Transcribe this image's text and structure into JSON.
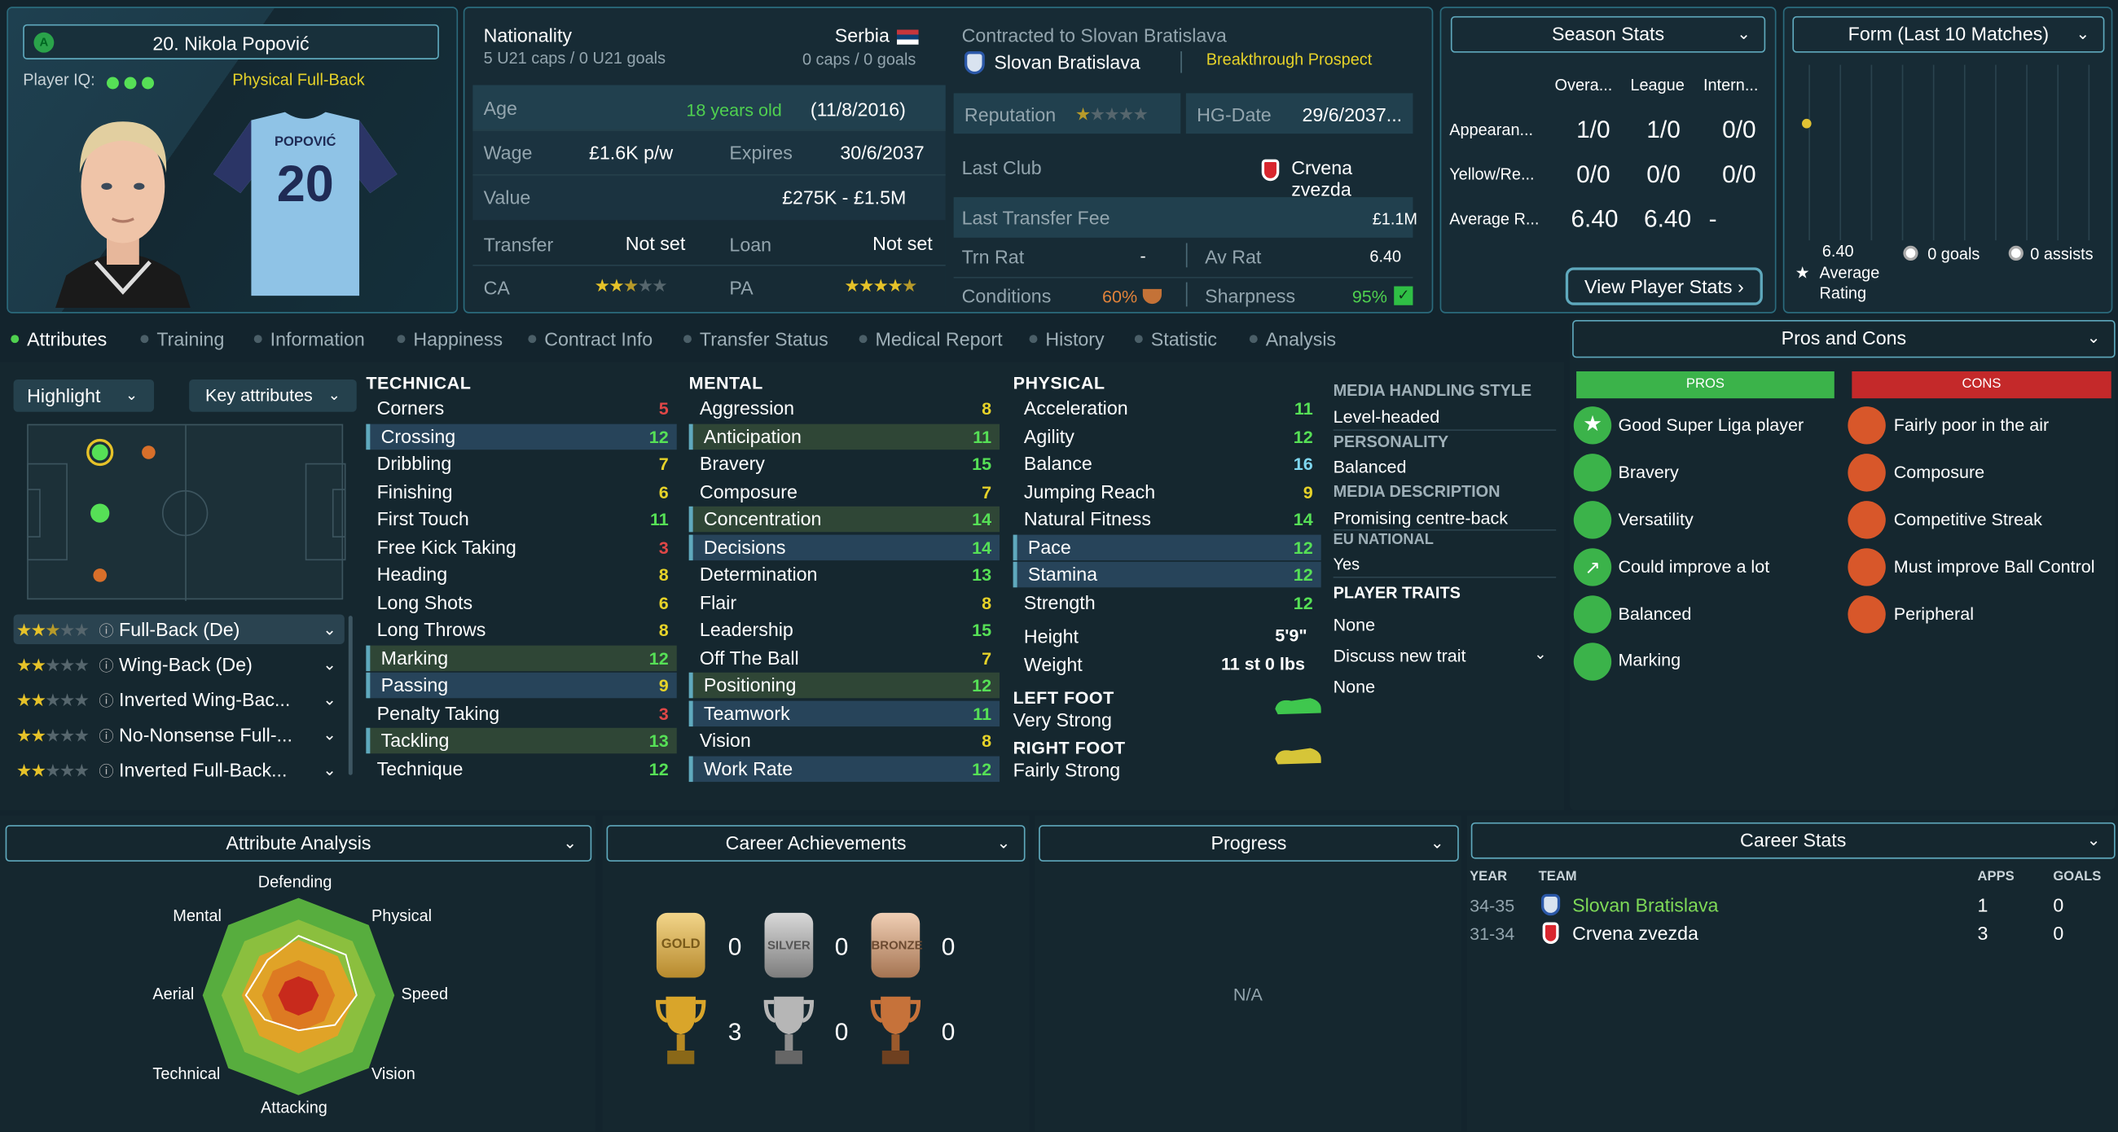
{
  "player": {
    "name": "20. Nikola Popović",
    "iq_label": "Player IQ:",
    "role_label": "Physical Full-Back",
    "shirt_name": "POPOVIĆ",
    "shirt_number": "20"
  },
  "nationality": {
    "label": "Nationality",
    "country": "Serbia",
    "u21": "5 U21 caps / 0 U21 goals",
    "caps": "0 caps / 0 goals"
  },
  "details": {
    "age_label": "Age",
    "age": "18 years old",
    "dob": "(11/8/2016)",
    "wage_label": "Wage",
    "wage": "£1.6K p/w",
    "expires_label": "Expires",
    "expires": "30/6/2037",
    "value_label": "Value",
    "value": "£275K - £1.5M",
    "transfer_label": "Transfer",
    "transfer": "Not set",
    "loan_label": "Loan",
    "loan": "Not set",
    "ca_label": "CA",
    "pa_label": "PA"
  },
  "contract": {
    "label": "Contracted to Slovan Bratislava",
    "club": "Slovan Bratislava",
    "prospect": "Breakthrough Prospect",
    "rep_label": "Reputation",
    "hg_label": "HG-Date",
    "hg": "29/6/2037...",
    "last_club_label": "Last Club",
    "last_club": "Crvena zvezda",
    "fee_label": "Last Transfer Fee",
    "fee": "£1.1M",
    "trn_label": "Trn Rat",
    "trn": "-",
    "av_label": "Av Rat",
    "av": "6.40",
    "cond_label": "Conditions",
    "cond": "60%",
    "sharp_label": "Sharpness",
    "sharp": "95%"
  },
  "season": {
    "title": "Season Stats",
    "cols": [
      "Overa...",
      "League",
      "Intern..."
    ],
    "rows": [
      {
        "label": "Appearan...",
        "v": [
          "1/0",
          "1/0",
          "0/0"
        ]
      },
      {
        "label": "Yellow/Re...",
        "v": [
          "0/0",
          "0/0",
          "0/0"
        ]
      },
      {
        "label": "Average R...",
        "v": [
          "6.40",
          "6.40",
          "-"
        ]
      }
    ],
    "button": "View Player Stats"
  },
  "form": {
    "title": "Form (Last 10 Matches)",
    "rating": "6.40",
    "rating_label": "Average Rating",
    "goals": "0 goals",
    "assists": "0 assists"
  },
  "tabs": [
    "Attributes",
    "Training",
    "Information",
    "Happiness",
    "Contract Info",
    "Transfer Status",
    "Medical Report",
    "History",
    "Statistic",
    "Analysis"
  ],
  "controls": {
    "highlight": "Highlight",
    "key": "Key attributes"
  },
  "technical": {
    "title": "TECHNICAL",
    "items": [
      [
        "Corners",
        "5"
      ],
      [
        "Crossing",
        "12"
      ],
      [
        "Dribbling",
        "7"
      ],
      [
        "Finishing",
        "6"
      ],
      [
        "First Touch",
        "11"
      ],
      [
        "Free Kick Taking",
        "3"
      ],
      [
        "Heading",
        "8"
      ],
      [
        "Long Shots",
        "6"
      ],
      [
        "Long Throws",
        "8"
      ],
      [
        "Marking",
        "12"
      ],
      [
        "Passing",
        "9"
      ],
      [
        "Penalty Taking",
        "3"
      ],
      [
        "Tackling",
        "13"
      ],
      [
        "Technique",
        "12"
      ]
    ]
  },
  "mental": {
    "title": "MENTAL",
    "items": [
      [
        "Aggression",
        "8"
      ],
      [
        "Anticipation",
        "11"
      ],
      [
        "Bravery",
        "15"
      ],
      [
        "Composure",
        "7"
      ],
      [
        "Concentration",
        "14"
      ],
      [
        "Decisions",
        "14"
      ],
      [
        "Determination",
        "13"
      ],
      [
        "Flair",
        "8"
      ],
      [
        "Leadership",
        "15"
      ],
      [
        "Off The Ball",
        "7"
      ],
      [
        "Positioning",
        "12"
      ],
      [
        "Teamwork",
        "11"
      ],
      [
        "Vision",
        "8"
      ],
      [
        "Work Rate",
        "12"
      ]
    ]
  },
  "physical": {
    "title": "PHYSICAL",
    "items": [
      [
        "Acceleration",
        "11"
      ],
      [
        "Agility",
        "12"
      ],
      [
        "Balance",
        "16"
      ],
      [
        "Jumping Reach",
        "9"
      ],
      [
        "Natural Fitness",
        "14"
      ],
      [
        "Pace",
        "12"
      ],
      [
        "Stamina",
        "12"
      ],
      [
        "Strength",
        "12"
      ]
    ],
    "height_label": "Height",
    "height": "5'9\"",
    "weight_label": "Weight",
    "weight": "11 st 0 lbs",
    "left_label": "LEFT FOOT",
    "left": "Very Strong",
    "right_label": "RIGHT FOOT",
    "right": "Fairly Strong"
  },
  "media": {
    "mh_label": "MEDIA HANDLING STYLE",
    "mh": "Level-headed",
    "pers_label": "PERSONALITY",
    "pers": "Balanced",
    "md_label": "MEDIA DESCRIPTION",
    "md": "Promising centre-back",
    "eu_label": "EU NATIONAL",
    "eu": "Yes",
    "traits_label": "PLAYER TRAITS",
    "traits": "None",
    "discuss": "Discuss new trait",
    "discuss_val": "None"
  },
  "roles": [
    "Full-Back (De)",
    "Wing-Back (De)",
    "Inverted Wing-Bac...",
    "No-Nonsense Full-...",
    "Inverted Full-Back..."
  ],
  "pros_cons": {
    "title": "Pros and Cons",
    "pros_label": "PROS",
    "cons_label": "CONS",
    "pros": [
      "Good Super Liga player",
      "Bravery",
      "Versatility",
      "Could improve a lot",
      "Balanced",
      "Marking"
    ],
    "cons": [
      "Fairly poor in the air",
      "Composure",
      "Competitive Streak",
      "Must improve Ball Control",
      "Peripheral"
    ]
  },
  "analysis": {
    "title": "Attribute Analysis",
    "labels": [
      "Defending",
      "Physical",
      "Speed",
      "Vision",
      "Attacking",
      "Technical",
      "Aerial",
      "Mental"
    ]
  },
  "achievements": {
    "title": "Career Achievements",
    "gold": "0",
    "silver": "0",
    "bronze": "0",
    "cup_gold": "3",
    "cup_silver": "0",
    "cup_bronze": "0",
    "medal_gold": "GOLD",
    "medal_silver": "SILVER",
    "medal_bronze": "BRONZE"
  },
  "progress": {
    "title": "Progress",
    "na": "N/A"
  },
  "career": {
    "title": "Career Stats",
    "cols": [
      "YEAR",
      "TEAM",
      "APPS",
      "GOALS"
    ],
    "rows": [
      {
        "year": "34-35",
        "team": "Slovan Bratislava",
        "apps": "1",
        "goals": "0"
      },
      {
        "year": "31-34",
        "team": "Crvena zvezda",
        "apps": "3",
        "goals": "0"
      }
    ]
  }
}
